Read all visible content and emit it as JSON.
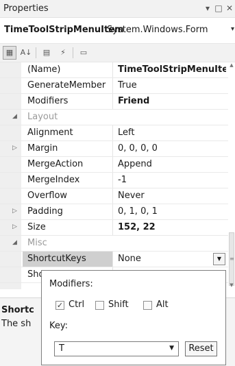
{
  "window": {
    "title": "Properties",
    "pin_icon": "▾",
    "restore_icon": "□",
    "close_icon": "✕"
  },
  "object_selector": {
    "name": "TimeToolStripMenuItem",
    "type": "System.Windows.Form",
    "dropdown_icon": "▾"
  },
  "toolbar": {
    "categorized_icon": "▦",
    "alphabetical_icon": "A↓",
    "properties_icon": "▤",
    "events_icon": "⚡",
    "property_pages_icon": "▭"
  },
  "grid": {
    "rows": [
      {
        "kind": "prop",
        "name": "(Name)",
        "value": "TimeToolStripMenuItem",
        "bold": true,
        "expander": ""
      },
      {
        "kind": "prop",
        "name": "GenerateMember",
        "value": "True",
        "bold": false,
        "expander": ""
      },
      {
        "kind": "prop",
        "name": "Modifiers",
        "value": "Friend",
        "bold": true,
        "expander": ""
      },
      {
        "kind": "cat",
        "name": "Layout",
        "expander": "◢"
      },
      {
        "kind": "prop",
        "name": "Alignment",
        "value": "Left",
        "bold": false,
        "expander": ""
      },
      {
        "kind": "prop",
        "name": "Margin",
        "value": "0, 0, 0, 0",
        "bold": false,
        "expander": "▷"
      },
      {
        "kind": "prop",
        "name": "MergeAction",
        "value": "Append",
        "bold": false,
        "expander": ""
      },
      {
        "kind": "prop",
        "name": "MergeIndex",
        "value": "-1",
        "bold": false,
        "expander": ""
      },
      {
        "kind": "prop",
        "name": "Overflow",
        "value": "Never",
        "bold": false,
        "expander": ""
      },
      {
        "kind": "prop",
        "name": "Padding",
        "value": "0, 1, 0, 1",
        "bold": false,
        "expander": "▷"
      },
      {
        "kind": "prop",
        "name": "Size",
        "value": "152, 22",
        "bold": true,
        "expander": "▷"
      },
      {
        "kind": "cat",
        "name": "Misc",
        "expander": "◢"
      },
      {
        "kind": "prop",
        "name": "ShortcutKeys",
        "value": "None",
        "bold": false,
        "expander": "",
        "selected": true,
        "dropdown": true
      },
      {
        "kind": "prop",
        "name": "Sho",
        "value": "",
        "bold": false,
        "expander": ""
      }
    ],
    "dropdown_arrow": "▼"
  },
  "scrollbar": {
    "up_icon": "▲",
    "down_icon": "▼",
    "grip_icon": "≡"
  },
  "description": {
    "title": "Shortc",
    "text": "The sh"
  },
  "shortcut_editor": {
    "modifiers_label": "Modifiers:",
    "ctrl_label": "Ctrl",
    "ctrl_checked": true,
    "shift_label": "Shift",
    "shift_checked": false,
    "alt_label": "Alt",
    "alt_checked": false,
    "check_mark": "✓",
    "key_label": "Key:",
    "key_value": "T",
    "key_dropdown_icon": "▼",
    "reset_label": "Reset"
  }
}
